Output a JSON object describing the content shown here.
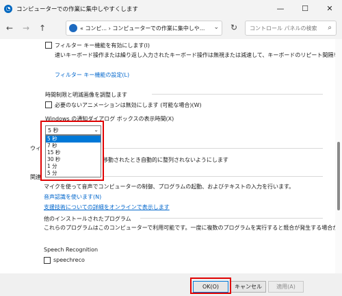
{
  "window": {
    "title": "コンピューターでの作業に集中しやすくします",
    "controls": {
      "minimize": "—",
      "maximize": "☐",
      "close": "✕"
    }
  },
  "nav": {
    "back": "←",
    "forward": "→",
    "up": "↑",
    "address": "« コンピ... › コンピューターでの作業に集中しや...",
    "refresh": "↻",
    "search_placeholder": "コントロール パネルの検索"
  },
  "filter_keys": {
    "checkbox_label": "フィルター キー機能を有効にします(I)",
    "description": "速いキーボード操作または繰り返し入力されたキーボード操作は無視または減速して、キーボードのリピート間隔を調整します。",
    "settings_link": "フィルター キー機能の設定(L)"
  },
  "time_limits": {
    "section_title": "時間制限と明滅画像を調整します",
    "animations_label": "必要のないアニメーションは無効にします (可能な場合)(W)",
    "dialog_time_label": "Windows の通知ダイアログ ボックスの表示時間(X)",
    "dropdown": {
      "selected": "5 秒",
      "options": [
        "5 秒",
        "7 秒",
        "15 秒",
        "30 秒",
        "1 分",
        "5 分"
      ],
      "highlighted_index": 0
    }
  },
  "window_mgmt": {
    "section_title_visible": "ウィ",
    "checkbox_label_visible": "移動されたとき自動的に整列されないようにします"
  },
  "related": {
    "section_title_visible": "関連",
    "description": "マイクを使って音声でコンピューターの制御、プログラムの起動、およびテキストの入力を行います。",
    "speech_link": "音声認識を使います(N)",
    "assistive_link": "支援技術についての詳細をオンラインで表示します"
  },
  "other_programs": {
    "section_title": "他のインストールされたプログラム",
    "description": "これらのプログラムはこのコンピューターで利用可能です。一度に複数のプログラムを実行すると競合が発生する場合があります。",
    "program_name": "Speech Recognition",
    "program_checkbox_label": "speechreco"
  },
  "footer": {
    "ok_label": "OK(O)",
    "cancel_label": "キャンセル",
    "apply_label": "適用(A)"
  },
  "colors": {
    "link": "#0066cc",
    "highlight": "#0078d7",
    "annotation": "#e00000"
  }
}
